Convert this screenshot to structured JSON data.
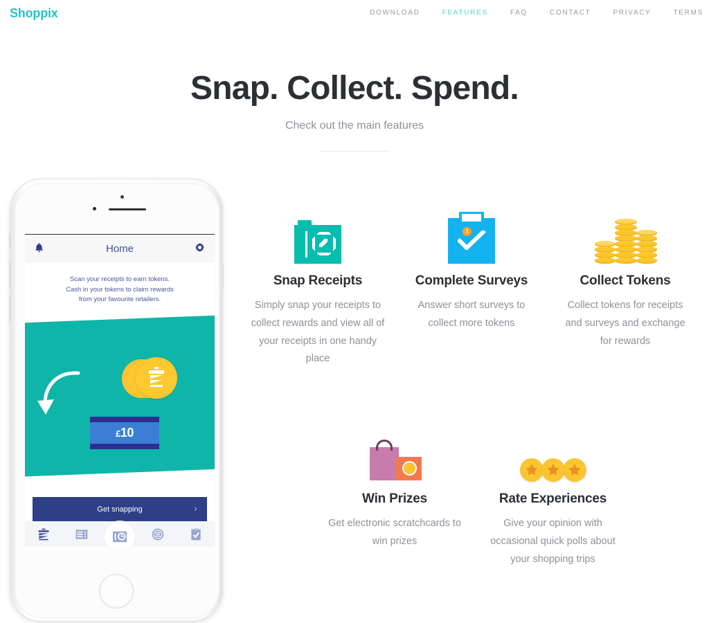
{
  "header": {
    "logo": "Shoppix",
    "nav": [
      {
        "label": "DOWNLOAD",
        "active": false
      },
      {
        "label": "FEATURES",
        "active": true
      },
      {
        "label": "FAQ",
        "active": false
      },
      {
        "label": "CONTACT",
        "active": false
      },
      {
        "label": "PRIVACY",
        "active": false
      },
      {
        "label": "TERMS",
        "active": false
      }
    ]
  },
  "hero": {
    "title": "Snap. Collect. Spend.",
    "subtitle": "Check out the main features"
  },
  "phone": {
    "app_bar_title": "Home",
    "bell_icon": "bell-icon",
    "gear_icon": "gear-icon",
    "copy_line1": "Scan your receipts to earn tokens.",
    "copy_line2": "Cash in your tokens to claim rewards",
    "copy_line3": "from your favourite retailers.",
    "note_currency": "£",
    "note_value": "10",
    "cta_label": "Get snapping",
    "cta_chevron": "›",
    "tabs": [
      {
        "name": "tokens-tab",
        "active": false
      },
      {
        "name": "receipts-list-tab",
        "active": false
      },
      {
        "name": "camera-tab",
        "active": true
      },
      {
        "name": "coins-tab",
        "active": false
      },
      {
        "name": "surveys-tab",
        "active": false
      }
    ]
  },
  "features": {
    "row1": [
      {
        "icon": "camera-icon",
        "title": "Snap Receipts",
        "desc": "Simply snap your receipts to collect rewards and view all of your receipts in one handy place"
      },
      {
        "icon": "clipboard-check-icon",
        "title": "Complete Surveys",
        "desc": "Answer short surveys to collect more tokens"
      },
      {
        "icon": "coin-stacks-icon",
        "title": "Collect Tokens",
        "desc": "Collect tokens for receipts and surveys and exchange for rewards"
      }
    ],
    "row2": [
      {
        "icon": "shopping-bags-icon",
        "title": "Win Prizes",
        "desc": "Get electronic scratchcards to win prizes"
      },
      {
        "icon": "star-coins-icon",
        "title": "Rate Experiences",
        "desc": "Give your opinion with occasional quick polls about your shopping trips"
      }
    ]
  },
  "colors": {
    "brand_teal": "#23c4c4",
    "nav_active": "#4fd2d2",
    "promo_teal": "#0fb5a8",
    "app_blue": "#2e3f87",
    "coin_gold": "#fcc72e",
    "survey_blue": "#14b2f0",
    "camera_teal": "#06bdb0"
  }
}
